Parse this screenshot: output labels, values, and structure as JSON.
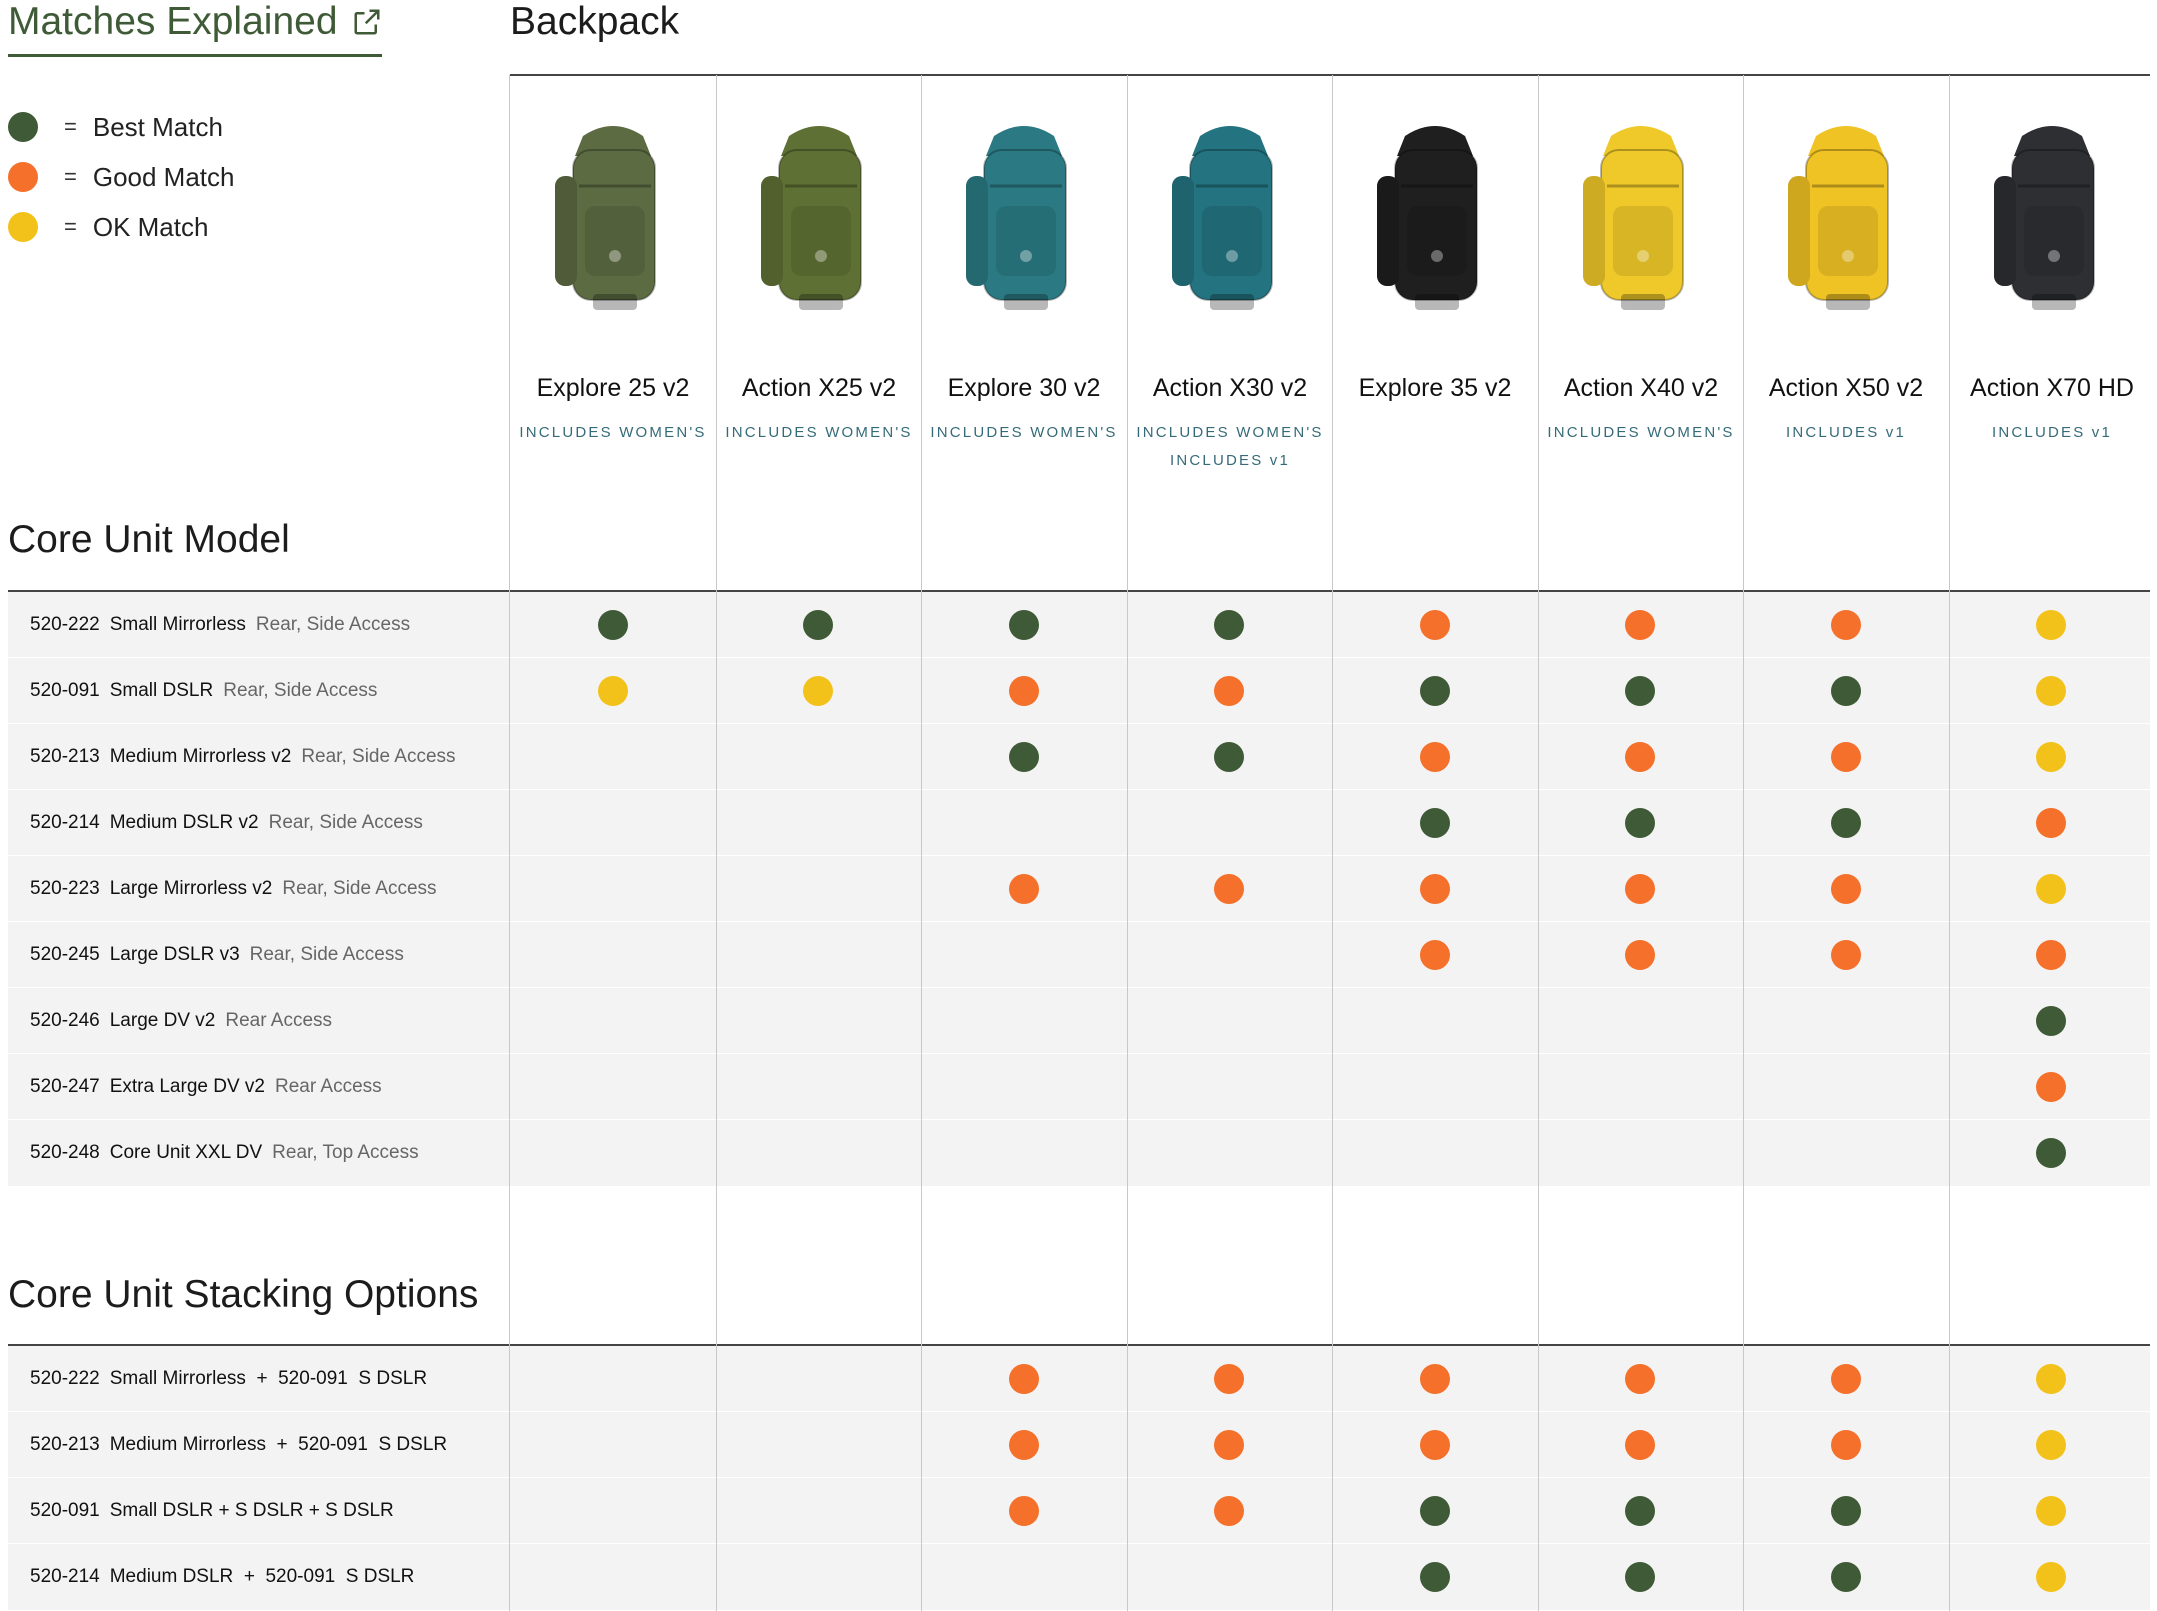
{
  "legend": {
    "title": "Matches Explained",
    "eq": "=",
    "items": [
      {
        "key": "best",
        "label": "Best Match",
        "color": "#3f5a36"
      },
      {
        "key": "good",
        "label": "Good Match",
        "color": "#f5702a"
      },
      {
        "key": "ok",
        "label": "OK Match",
        "color": "#f2c21b"
      }
    ]
  },
  "backpack_heading": "Backpack",
  "products": [
    {
      "name": "Explore 25 v2",
      "notes": [
        "INCLUDES WOMEN'S"
      ],
      "color": "#5d6b43"
    },
    {
      "name": "Action X25 v2",
      "notes": [
        "INCLUDES WOMEN'S"
      ],
      "color": "#5f7034"
    },
    {
      "name": "Explore 30 v2",
      "notes": [
        "INCLUDES WOMEN'S"
      ],
      "color": "#2b7a83"
    },
    {
      "name": "Action X30 v2",
      "notes": [
        "INCLUDES WOMEN'S",
        "INCLUDES v1"
      ],
      "color": "#237480"
    },
    {
      "name": "Explore 35 v2",
      "notes": [],
      "color": "#1f1f1f"
    },
    {
      "name": "Action X40 v2",
      "notes": [
        "INCLUDES WOMEN'S"
      ],
      "color": "#efc92a"
    },
    {
      "name": "Action X50 v2",
      "notes": [
        "INCLUDES v1"
      ],
      "color": "#f0c325"
    },
    {
      "name": "Action X70 HD",
      "notes": [
        "INCLUDES v1"
      ],
      "color": "#2d2f33"
    }
  ],
  "sections": [
    {
      "title": "Core Unit Model",
      "rows": [
        {
          "code": "520-222",
          "name": "Small Mirrorless",
          "access": "Rear, Side Access",
          "matches": [
            "best",
            "best",
            "best",
            "best",
            "good",
            "good",
            "good",
            "ok"
          ]
        },
        {
          "code": "520-091",
          "name": "Small DSLR",
          "access": "Rear, Side Access",
          "matches": [
            "ok",
            "ok",
            "good",
            "good",
            "best",
            "best",
            "best",
            "ok"
          ]
        },
        {
          "code": "520-213",
          "name": "Medium Mirrorless v2",
          "access": "Rear, Side Access",
          "matches": [
            "",
            "",
            "best",
            "best",
            "good",
            "good",
            "good",
            "ok"
          ]
        },
        {
          "code": "520-214",
          "name": "Medium DSLR v2",
          "access": "Rear, Side Access",
          "matches": [
            "",
            "",
            "",
            "",
            "best",
            "best",
            "best",
            "good"
          ]
        },
        {
          "code": "520-223",
          "name": "Large Mirrorless v2",
          "access": "Rear, Side Access",
          "matches": [
            "",
            "",
            "good",
            "good",
            "good",
            "good",
            "good",
            "ok"
          ]
        },
        {
          "code": "520-245",
          "name": "Large DSLR v3",
          "access": "Rear, Side Access",
          "matches": [
            "",
            "",
            "",
            "",
            "good",
            "good",
            "good",
            "good"
          ]
        },
        {
          "code": "520-246",
          "name": "Large DV v2",
          "access": "Rear Access",
          "matches": [
            "",
            "",
            "",
            "",
            "",
            "",
            "",
            "best"
          ]
        },
        {
          "code": "520-247",
          "name": "Extra Large DV v2",
          "access": "Rear Access",
          "matches": [
            "",
            "",
            "",
            "",
            "",
            "",
            "",
            "good"
          ]
        },
        {
          "code": "520-248",
          "name": "Core Unit XXL DV",
          "access": "Rear, Top Access",
          "matches": [
            "",
            "",
            "",
            "",
            "",
            "",
            "",
            "best"
          ]
        }
      ]
    },
    {
      "title": "Core Unit Stacking Options",
      "rows": [
        {
          "code": "520-222",
          "name": "Small Mirrorless  +  520-091  S DSLR",
          "access": "",
          "matches": [
            "",
            "",
            "good",
            "good",
            "good",
            "good",
            "good",
            "ok"
          ]
        },
        {
          "code": "520-213",
          "name": "Medium Mirrorless  +  520-091  S DSLR",
          "access": "",
          "matches": [
            "",
            "",
            "good",
            "good",
            "good",
            "good",
            "good",
            "ok"
          ]
        },
        {
          "code": "520-091",
          "name": "Small DSLR + S DSLR + S DSLR",
          "access": "",
          "matches": [
            "",
            "",
            "good",
            "good",
            "best",
            "best",
            "best",
            "ok"
          ]
        },
        {
          "code": "520-214",
          "name": "Medium DSLR  +  520-091  S DSLR",
          "access": "",
          "matches": [
            "",
            "",
            "",
            "",
            "best",
            "best",
            "best",
            "ok"
          ]
        }
      ]
    }
  ]
}
